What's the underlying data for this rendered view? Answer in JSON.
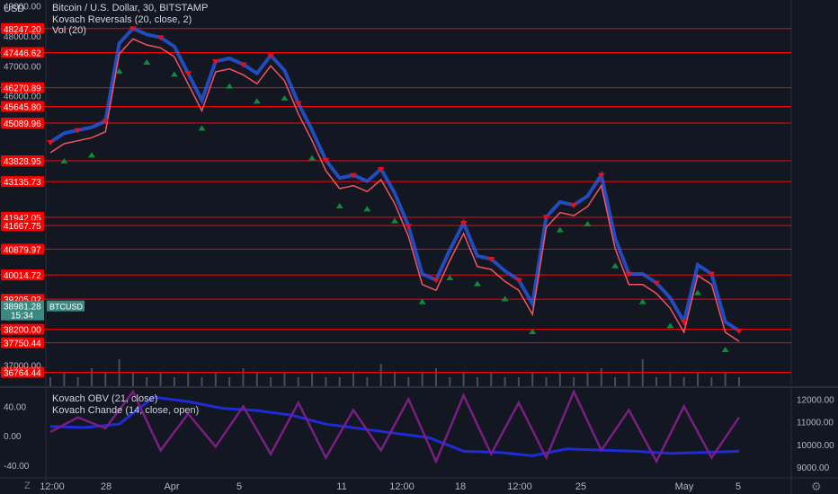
{
  "colors": {
    "background": "#131722",
    "level_line": "#ff0000",
    "price_line": "#f7525f",
    "upper_band": "#2962ff",
    "buy_marker": "#0f8a3a",
    "sell_marker": "#e0121b",
    "obv_line": "#1f2bd8",
    "chande_line": "#7a1f82",
    "volume_bar": "#4a4d57",
    "grid": "#1e222d"
  },
  "header": {
    "currency": "USD",
    "title": "Bitcoin / U.S. Dollar, 30, BITSTAMP",
    "indicator_1": "Kovach Reversals (20, close, 2)",
    "indicator_2": "Vol (20)"
  },
  "lower_pane": {
    "indicator_1": "Kovach OBV (21, close)",
    "indicator_2": "Kovach Chande (14, close, open)"
  },
  "current_price": {
    "value": "38981.28",
    "countdown": "15:34",
    "symbol": "BTCUSD"
  },
  "bottom_bar": {
    "left_icon": "Z",
    "right_icon": "gear"
  },
  "chart_data": [
    {
      "type": "line",
      "title": "Bitcoin / U.S. Dollar, 30, BITSTAMP",
      "x_tick_labels": [
        "12:00",
        "28",
        "Apr",
        "5",
        "11",
        "12:00",
        "18",
        "12:00",
        "25",
        "May",
        "5"
      ],
      "y_axis_ticks": [
        "49000.00",
        "48000.00",
        "47000.00",
        "46000.00",
        "37000.00"
      ],
      "ylim": [
        36300,
        49200
      ],
      "horizontal_levels": [
        48247.2,
        47446.62,
        46270.89,
        45645.8,
        45089.96,
        43828.95,
        43135.73,
        41942.05,
        41667.75,
        40879.97,
        40014.72,
        39205.02,
        38200.0,
        37750.44,
        36764.44
      ],
      "series": [
        {
          "x": [
            0,
            2,
            4,
            6,
            8,
            10,
            12,
            14,
            16,
            18,
            20,
            22,
            24,
            26,
            28,
            30,
            32,
            34,
            36,
            38,
            40,
            42,
            44,
            46,
            48,
            50,
            52,
            54,
            56,
            58,
            60,
            62,
            64,
            66,
            68,
            70,
            72,
            74,
            76,
            78,
            80,
            82,
            84,
            86,
            88,
            90,
            92,
            94,
            96,
            98,
            100
          ],
          "values": [
            44100,
            44400,
            44500,
            44600,
            44800,
            47400,
            47900,
            47700,
            47600,
            47300,
            46400,
            45500,
            46800,
            46900,
            46700,
            46400,
            47000,
            46500,
            45400,
            44500,
            43500,
            42900,
            43000,
            42800,
            43200,
            42400,
            41300,
            39700,
            39500,
            40500,
            41400,
            40300,
            40200,
            39800,
            39500,
            38700,
            41600,
            42100,
            42000,
            42300,
            43000,
            40900,
            39700,
            39700,
            39400,
            38900,
            38100,
            40000,
            39700,
            38100,
            37800
          ]
        }
      ]
    },
    {
      "type": "bar",
      "title": "Vol (20)",
      "values": [
        2,
        3,
        2,
        4,
        3,
        6,
        3,
        2,
        3,
        2,
        3,
        2,
        3,
        2,
        4,
        3,
        2,
        3,
        2,
        3,
        2,
        2,
        3,
        2,
        5,
        3,
        2,
        3,
        4,
        2,
        3,
        2,
        3,
        2,
        2,
        3,
        2,
        3,
        2,
        3,
        4,
        2,
        3,
        6,
        2,
        3,
        2,
        3,
        2,
        3,
        2
      ]
    },
    {
      "type": "line",
      "title": "Kovach Chande (14, close, open)",
      "x_tick_labels": [
        "12:00",
        "28",
        "Apr",
        "5",
        "11",
        "12:00",
        "18",
        "12:00",
        "25",
        "May",
        "5"
      ],
      "left_axis_ticks": [
        "40.00",
        "0.00",
        "-40.00"
      ],
      "right_axis_ticks": [
        "12000.00",
        "11000.00",
        "10000.00",
        "9000.00"
      ],
      "left_ylim": [
        -55,
        65
      ],
      "right_ylim": [
        8600,
        12500
      ],
      "series": [
        {
          "name": "Kovach OBV (21, close)",
          "axis": "right",
          "x": [
            0,
            5,
            10,
            15,
            20,
            25,
            30,
            35,
            40,
            45,
            50,
            55,
            60,
            65,
            70,
            75,
            80,
            85,
            90,
            95,
            100
          ],
          "values": [
            10800,
            10750,
            10900,
            12100,
            11900,
            11600,
            11500,
            11300,
            10900,
            10700,
            10500,
            10300,
            9700,
            9650,
            9500,
            9800,
            9750,
            9700,
            9600,
            9650,
            9700
          ]
        },
        {
          "name": "Kovach Chande (14, close, open)",
          "axis": "left",
          "x": [
            0,
            4,
            8,
            12,
            16,
            20,
            24,
            28,
            32,
            36,
            40,
            44,
            48,
            52,
            56,
            60,
            64,
            68,
            72,
            76,
            80,
            84,
            88,
            92,
            96,
            100
          ],
          "values": [
            5,
            25,
            10,
            60,
            -20,
            30,
            -15,
            40,
            -25,
            45,
            -30,
            35,
            -20,
            50,
            -35,
            55,
            -25,
            45,
            -30,
            60,
            -20,
            35,
            -35,
            40,
            -30,
            25
          ]
        }
      ]
    }
  ]
}
